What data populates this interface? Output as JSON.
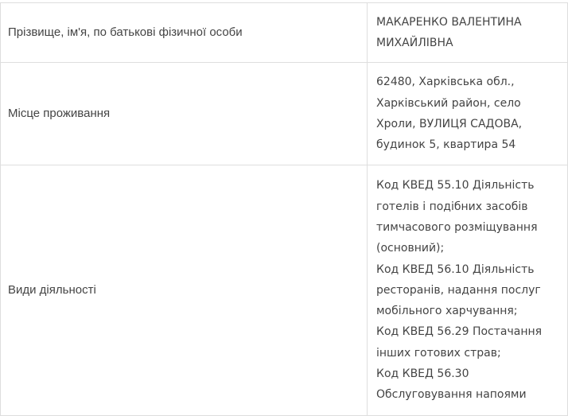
{
  "rows": [
    {
      "label": "Прізвище, ім'я, по батькові фізичної особи",
      "value_lines": [
        "МАКАРЕНКО ВАЛЕНТИНА",
        "МИХАЙЛІВНА"
      ]
    },
    {
      "label": "Місце проживання",
      "value_lines": [
        "62480, Харківська обл.,",
        "Харківський район, село",
        "Хроли, ВУЛИЦЯ САДОВА,",
        "будинок 5, квартира 54"
      ]
    },
    {
      "label": "Види діяльності",
      "value_lines": [
        "Код КВЕД 55.10 Діяльність",
        "готелів і подібних засобів",
        "тимчасового розміщування",
        "(основний);",
        "Код КВЕД 56.10 Діяльність",
        "ресторанів, надання послуг",
        "мобільного харчування;",
        "Код КВЕД 56.29 Постачання",
        "інших готових страв;",
        "Код КВЕД 56.30",
        "Обслуговування напоями"
      ]
    }
  ],
  "colors": {
    "text": "#444444",
    "border": "#dedede",
    "background": "#ffffff"
  }
}
